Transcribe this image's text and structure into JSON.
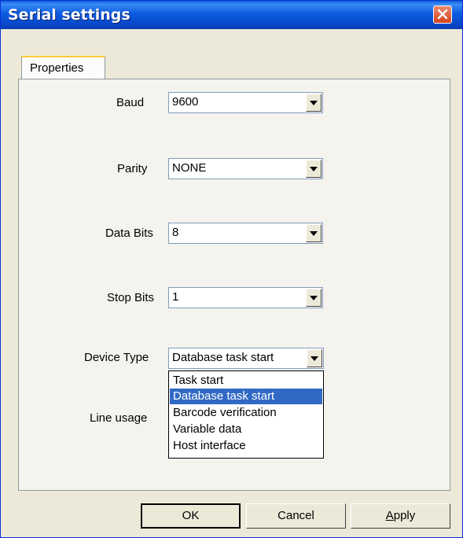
{
  "window": {
    "title": "Serial settings"
  },
  "tabs": [
    {
      "label": "Properties"
    }
  ],
  "fields": {
    "baud": {
      "label": "Baud",
      "value": "9600"
    },
    "parity": {
      "label": "Parity",
      "value": "NONE"
    },
    "data_bits": {
      "label": "Data Bits",
      "value": "8"
    },
    "stop_bits": {
      "label": "Stop Bits",
      "value": "1"
    },
    "device_type": {
      "label": "Device Type",
      "value": "Database task start"
    },
    "line_usage": {
      "label": "Line usage"
    }
  },
  "device_type_options": [
    "Task start",
    "Database task start",
    "Barcode verification",
    "Variable data",
    "Host interface"
  ],
  "selected_option_index": 1,
  "buttons": {
    "ok": "OK",
    "cancel": "Cancel",
    "apply_prefix": "",
    "apply_mnemonic": "A",
    "apply_rest": "pply"
  },
  "colors": {
    "titlebar": "#0A5FD8",
    "close_button": "#D5431C",
    "selection": "#316AC5",
    "dialog_bg": "#ECE9D8"
  },
  "icons": {
    "close": "close-icon",
    "combo_arrow": "chevron-down-icon"
  }
}
